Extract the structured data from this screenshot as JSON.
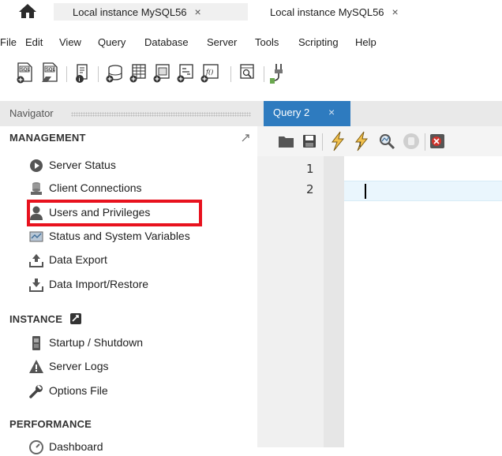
{
  "window_tabs": [
    {
      "label": "Local instance MySQL56",
      "close": "×"
    },
    {
      "label": "Local instance MySQL56",
      "close": "×"
    }
  ],
  "menu": [
    "File",
    "Edit",
    "View",
    "Query",
    "Database",
    "Server",
    "Tools",
    "Scripting",
    "Help"
  ],
  "toolbar_icons": [
    "new-sql-tab-icon",
    "open-sql-script-icon",
    "info-icon",
    "create-schema-icon",
    "create-table-icon",
    "create-view-icon",
    "create-procedure-icon",
    "create-function-icon",
    "search-table-data-icon",
    "reconnect-icon"
  ],
  "navigator": {
    "title": "Navigator",
    "sections": {
      "management": {
        "title": "MANAGEMENT",
        "items": [
          {
            "label": "Server Status",
            "icon": "server-status-icon"
          },
          {
            "label": "Client Connections",
            "icon": "client-connections-icon"
          },
          {
            "label": "Users and Privileges",
            "icon": "user-icon"
          },
          {
            "label": "Status and System Variables",
            "icon": "status-variables-icon"
          },
          {
            "label": "Data Export",
            "icon": "data-export-icon"
          },
          {
            "label": "Data Import/Restore",
            "icon": "data-import-icon"
          }
        ]
      },
      "instance": {
        "title": "INSTANCE",
        "items": [
          {
            "label": "Startup / Shutdown",
            "icon": "startup-shutdown-icon"
          },
          {
            "label": "Server Logs",
            "icon": "server-logs-icon"
          },
          {
            "label": "Options File",
            "icon": "wrench-icon"
          }
        ]
      },
      "performance": {
        "title": "PERFORMANCE",
        "items": [
          {
            "label": "Dashboard",
            "icon": "dashboard-icon"
          }
        ]
      }
    }
  },
  "editor": {
    "tab_label": "Query 2",
    "tab_close": "×",
    "line_numbers": [
      "1",
      "2"
    ],
    "query_toolbar_icons": [
      "open-file-icon",
      "save-icon",
      "execute-icon",
      "execute-current-icon",
      "explain-icon",
      "stop-icon",
      "toggle-error-icon"
    ]
  },
  "colors": {
    "highlight_box": "#e8121e",
    "query_tab_active": "#2e7bbf",
    "current_line": "#eaf6fd"
  }
}
